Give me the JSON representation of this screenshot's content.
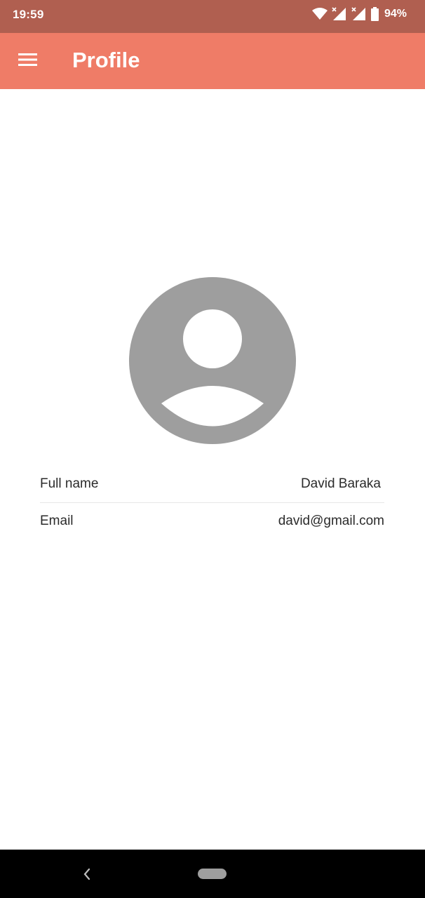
{
  "status_bar": {
    "time": "19:59",
    "battery": "94%",
    "icons": [
      "wifi-icon",
      "signal-icon",
      "signal-icon",
      "battery-icon"
    ]
  },
  "app_bar": {
    "title": "Profile",
    "menu_icon": "hamburger-menu-icon",
    "color": "#ef7c67"
  },
  "profile": {
    "avatar_icon": "account-circle-icon",
    "rows": [
      {
        "label": "Full name",
        "value": "David Baraka"
      },
      {
        "label": "Email",
        "value": "david@gmail.com"
      }
    ]
  },
  "nav_bar": {
    "back_icon": "back-chevron-icon",
    "home_icon": "home-pill-icon"
  },
  "colors": {
    "status_bar": "#b05f50",
    "app_bar": "#ef7c67",
    "avatar": "#9e9e9e"
  }
}
